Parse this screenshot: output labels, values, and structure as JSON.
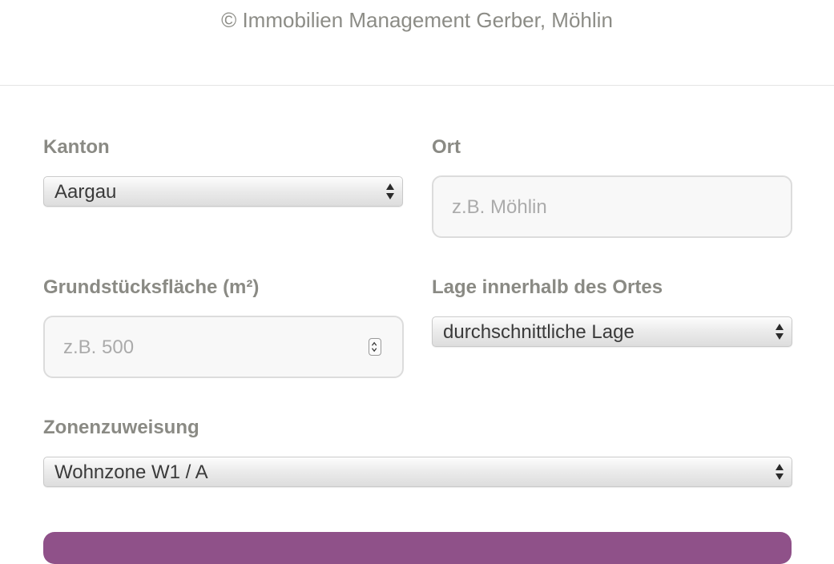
{
  "header": {
    "copyright": "© Immobilien Management Gerber, Möhlin"
  },
  "form": {
    "kanton": {
      "label": "Kanton",
      "value": "Aargau"
    },
    "ort": {
      "label": "Ort",
      "placeholder": "z.B. Möhlin"
    },
    "grundstuecksflaeche": {
      "label": "Grundstücksfläche (m²)",
      "placeholder": "z.B. 500"
    },
    "lage": {
      "label": "Lage innerhalb des Ortes",
      "value": "durchschnittliche Lage"
    },
    "zonenzuweisung": {
      "label": "Zonenzuweisung",
      "value": "Wohnzone W1 / A"
    }
  },
  "colors": {
    "accent": "#8f5189",
    "label": "#8a8a84",
    "placeholder": "#ababab"
  }
}
